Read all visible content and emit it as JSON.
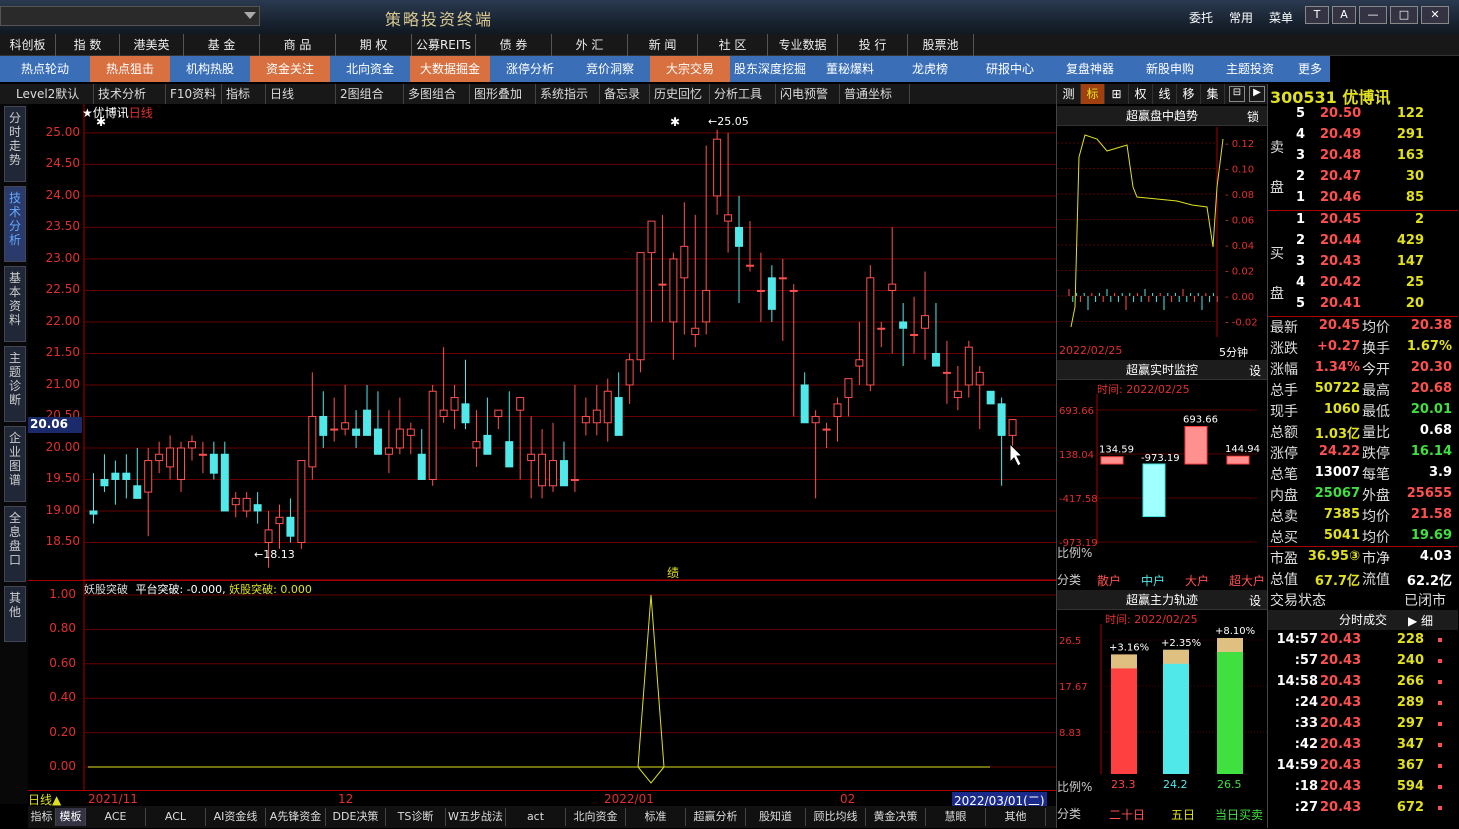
{
  "window": {
    "title": "策略投资终端",
    "menus": [
      "委托",
      "常用",
      "菜单"
    ]
  },
  "nav1": [
    "科创板",
    "指 数",
    "港美英",
    "基 金",
    "商 品",
    "期 权",
    "公募REITs",
    "债 券",
    "外 汇",
    "新 闻",
    "社 区",
    "专业数据",
    "投 行",
    "股票池"
  ],
  "nav2": [
    "热点轮动",
    "热点狙击",
    "机构热股",
    "资金关注",
    "北向资金",
    "大数据掘金",
    "涨停分析",
    "竞价洞察",
    "大宗交易",
    "股东深度挖掘",
    "董秘爆料",
    "龙虎榜",
    "研报中心",
    "复盘神器",
    "新股申购",
    "主题投资",
    "更多"
  ],
  "toolbar": [
    "Level2默认",
    "技术分析",
    "F10资料",
    "指标",
    "日线",
    "2图组合",
    "多图组合",
    "图形叠加",
    "系统指示",
    "备忘录",
    "历史回忆",
    "分析工具",
    "闪电预警",
    "普通坐标"
  ],
  "left_tabs": [
    "分时走势",
    "技术分析",
    "基本资料",
    "主题诊断",
    "企业图谱",
    "全息盘口",
    "其他"
  ],
  "main": {
    "name": "★优博讯",
    "period": "日线",
    "y_ticks": [
      "25.00",
      "24.50",
      "24.00",
      "23.50",
      "23.00",
      "22.50",
      "22.00",
      "21.50",
      "21.00",
      "20.50",
      "20.00",
      "19.50",
      "19.00",
      "18.50"
    ],
    "current_price": "20.06",
    "high_label": "25.05",
    "low_label": "18.13",
    "marker": "绩"
  },
  "sub": {
    "title": "妖股突破",
    "line2": "平台突破: -0.000,",
    "line3": "妖股突破: 0.000",
    "y_ticks": [
      "1.00",
      "0.80",
      "0.60",
      "0.40",
      "0.20",
      "0.00"
    ]
  },
  "timebar": {
    "period": "日线▲",
    "dates": [
      "2021/11",
      "12",
      "2022/01",
      "02",
      "2022/03/01(二)"
    ]
  },
  "bottom_tabs": [
    "指标",
    "模板",
    "ACE",
    "ACL",
    "AI资金线",
    "A先锋资金",
    "DDE决策",
    "TS诊断",
    "W五步战法",
    "act",
    "北向资金",
    "标准",
    "超赢分析",
    "股知道",
    "顾比均线",
    "黄金决策",
    "慧眼",
    "其他"
  ],
  "mid": {
    "tabs": [
      "测",
      "标",
      "⊞",
      "权",
      "线",
      "移",
      "集"
    ],
    "p1": {
      "title": "超赢盘中趋势",
      "lock": "锁",
      "date": "2022/02/25",
      "interval": "5分钟",
      "ticks": [
        "0.12",
        "0.10",
        "0.08",
        "0.06",
        "0.04",
        "0.02",
        "0.00",
        "-0.02"
      ]
    },
    "p2": {
      "title": "超赢实时监控",
      "setting": "设",
      "time_label": "时间: 2022/02/25",
      "ticks": [
        "693.66",
        "138.04",
        "-417.58",
        "-973.19"
      ],
      "values_label": [
        "134.59",
        "-973.19",
        "693.66",
        "144.94"
      ],
      "ratio": "比例%",
      "categories_label": "分类",
      "cats": [
        "散户",
        "中户",
        "大户",
        "超大户"
      ]
    },
    "p3": {
      "title": "超赢主力轨迹",
      "setting": "设",
      "time_label": "时间: 2022/02/25",
      "pcts": [
        "+3.16%",
        "+2.35%",
        "+8.10%"
      ],
      "ticks": [
        "26.5",
        "17.67",
        "8.83"
      ],
      "vals": [
        "23.3",
        "24.2",
        "26.5"
      ],
      "ratio": "比例%",
      "categories_label": "分类",
      "cats": [
        "二十日",
        "五日",
        "当日买卖"
      ]
    }
  },
  "quote": {
    "code": "300531",
    "name": "优博讯",
    "sell_label": "卖 盘",
    "buy_label": "买 盘",
    "sells": [
      [
        "5",
        "20.50",
        "122"
      ],
      [
        "4",
        "20.49",
        "291"
      ],
      [
        "3",
        "20.48",
        "163"
      ],
      [
        "2",
        "20.47",
        "30"
      ],
      [
        "1",
        "20.46",
        "85"
      ]
    ],
    "buys": [
      [
        "1",
        "20.45",
        "2"
      ],
      [
        "2",
        "20.44",
        "429"
      ],
      [
        "3",
        "20.43",
        "147"
      ],
      [
        "4",
        "20.42",
        "25"
      ],
      [
        "5",
        "20.41",
        "20"
      ]
    ],
    "stats": [
      [
        "最新",
        "20.45",
        "均价",
        "20.38"
      ],
      [
        "涨跌",
        "+0.27",
        "换手",
        "1.67%"
      ],
      [
        "涨幅",
        "1.34%",
        "今开",
        "20.30"
      ],
      [
        "总手",
        "50722",
        "最高",
        "20.68"
      ],
      [
        "现手",
        "1060",
        "最低",
        "20.01"
      ],
      [
        "总额",
        "1.03亿",
        "量比",
        "0.68"
      ],
      [
        "涨停",
        "24.22",
        "跌停",
        "16.14"
      ],
      [
        "总笔",
        "13007",
        "每笔",
        "3.9"
      ],
      [
        "内盘",
        "25067",
        "外盘",
        "25655"
      ],
      [
        "总卖",
        "7385",
        "均价",
        "21.58"
      ],
      [
        "总买",
        "5041",
        "均价",
        "19.69"
      ],
      [
        "市盈",
        "36.95③",
        "市净",
        "4.03"
      ],
      [
        "总值",
        "67.7亿",
        "流值",
        "62.2亿"
      ]
    ],
    "trade_state_label": "交易状态",
    "trade_state": "已闭市",
    "ticks_title": "分时成交",
    "ticks_btn": "细",
    "trades": [
      [
        "14:57",
        "20.43",
        "228"
      ],
      [
        ":57",
        "20.43",
        "240"
      ],
      [
        "14:58",
        "20.43",
        "266"
      ],
      [
        ":24",
        "20.43",
        "289"
      ],
      [
        ":33",
        "20.43",
        "297"
      ],
      [
        ":42",
        "20.43",
        "347"
      ],
      [
        "14:59",
        "20.43",
        "367"
      ],
      [
        ":18",
        "20.43",
        "594"
      ],
      [
        ":27",
        "20.43",
        "672"
      ]
    ]
  },
  "chart_data": {
    "type": "candlestick",
    "y_range": [
      18.0,
      25.3
    ],
    "candles": [
      [
        19.0,
        19.6,
        18.8,
        18.95
      ],
      [
        19.5,
        19.9,
        19.3,
        19.4
      ],
      [
        19.6,
        19.8,
        19.1,
        19.5
      ],
      [
        19.6,
        19.9,
        19.2,
        19.5
      ],
      [
        19.4,
        20.0,
        19.2,
        19.2
      ],
      [
        19.3,
        20.0,
        18.6,
        19.8
      ],
      [
        19.8,
        20.1,
        19.6,
        19.9
      ],
      [
        19.7,
        20.2,
        19.5,
        20.0
      ],
      [
        19.5,
        20.1,
        19.3,
        20.0
      ],
      [
        20.0,
        20.2,
        19.8,
        20.1
      ],
      [
        19.9,
        20.1,
        19.6,
        19.9
      ],
      [
        19.9,
        20.1,
        19.5,
        19.6
      ],
      [
        19.9,
        20.1,
        19.0,
        19.0
      ],
      [
        19.1,
        19.3,
        18.9,
        19.2
      ],
      [
        19.0,
        19.3,
        18.9,
        19.2
      ],
      [
        19.1,
        19.3,
        18.8,
        19.0
      ],
      [
        18.5,
        19.0,
        18.1,
        18.7
      ],
      [
        18.8,
        19.1,
        18.4,
        18.9
      ],
      [
        18.9,
        19.2,
        18.5,
        18.6
      ],
      [
        18.5,
        19.8,
        18.4,
        19.8
      ],
      [
        19.7,
        21.2,
        19.5,
        20.5
      ],
      [
        20.5,
        20.9,
        20.0,
        20.2
      ],
      [
        20.3,
        20.8,
        20.1,
        20.3
      ],
      [
        20.3,
        21.0,
        20.2,
        20.4
      ],
      [
        20.3,
        20.6,
        20.0,
        20.2
      ],
      [
        20.6,
        21.0,
        20.3,
        20.2
      ],
      [
        20.3,
        20.9,
        19.9,
        19.9
      ],
      [
        19.9,
        20.6,
        19.6,
        20.0
      ],
      [
        20.0,
        20.8,
        19.9,
        20.3
      ],
      [
        20.2,
        20.4,
        19.9,
        20.3
      ],
      [
        19.9,
        20.3,
        19.5,
        19.5
      ],
      [
        19.5,
        21.0,
        19.4,
        20.9
      ],
      [
        20.5,
        21.6,
        20.4,
        20.6
      ],
      [
        20.6,
        21.0,
        20.3,
        20.8
      ],
      [
        20.7,
        21.4,
        20.3,
        20.4
      ],
      [
        20.0,
        20.6,
        19.7,
        20.1
      ],
      [
        20.2,
        20.8,
        19.9,
        19.9
      ],
      [
        20.5,
        20.6,
        20.3,
        20.6
      ],
      [
        20.1,
        20.9,
        19.8,
        19.7
      ],
      [
        20.6,
        20.8,
        19.5,
        20.8
      ],
      [
        19.8,
        20.5,
        19.2,
        19.9
      ],
      [
        19.4,
        20.3,
        19.2,
        19.9
      ],
      [
        19.4,
        20.4,
        19.3,
        19.8
      ],
      [
        19.8,
        20.1,
        19.5,
        19.4
      ],
      [
        19.5,
        21.0,
        19.3,
        19.5
      ],
      [
        20.4,
        20.8,
        20.2,
        20.5
      ],
      [
        20.4,
        21.0,
        20.2,
        20.6
      ],
      [
        20.4,
        21.1,
        20.1,
        20.9
      ],
      [
        20.8,
        21.2,
        20.4,
        20.2
      ],
      [
        21.0,
        21.5,
        20.7,
        21.4
      ],
      [
        21.4,
        23.0,
        21.2,
        23.1
      ],
      [
        23.1,
        23.6,
        22.0,
        23.6
      ],
      [
        22.6,
        23.7,
        22.0,
        22.6
      ],
      [
        22.0,
        23.1,
        21.4,
        23.0
      ],
      [
        22.7,
        23.9,
        21.8,
        23.2
      ],
      [
        21.8,
        23.7,
        21.6,
        21.9
      ],
      [
        22.0,
        24.8,
        21.8,
        22.5
      ],
      [
        24.0,
        25.05,
        23.7,
        24.9
      ],
      [
        23.6,
        25.0,
        23.1,
        23.7
      ],
      [
        23.5,
        24.0,
        22.3,
        23.2
      ],
      [
        22.9,
        23.6,
        22.8,
        22.9
      ],
      [
        22.5,
        23.1,
        22.0,
        22.5
      ],
      [
        22.7,
        22.9,
        22.0,
        22.2
      ],
      [
        22.7,
        23.0,
        21.7,
        22.7
      ],
      [
        22.5,
        22.6,
        20.5,
        22.5
      ],
      [
        21.0,
        21.2,
        20.4,
        20.4
      ],
      [
        20.4,
        20.6,
        19.2,
        20.5
      ],
      [
        20.3,
        20.4,
        20.0,
        20.3
      ],
      [
        20.5,
        20.8,
        20.1,
        20.7
      ],
      [
        20.8,
        21.0,
        20.5,
        21.1
      ],
      [
        21.3,
        22.0,
        21.0,
        21.4
      ],
      [
        21.0,
        22.9,
        20.9,
        22.7
      ],
      [
        21.9,
        22.0,
        21.6,
        21.9
      ],
      [
        22.5,
        23.5,
        21.5,
        22.6
      ],
      [
        22.0,
        22.3,
        21.3,
        21.9
      ],
      [
        21.8,
        22.4,
        21.5,
        21.8
      ],
      [
        21.9,
        22.8,
        21.4,
        22.1
      ],
      [
        21.5,
        22.3,
        21.3,
        21.3
      ],
      [
        21.2,
        21.7,
        20.7,
        21.2
      ],
      [
        20.8,
        21.3,
        20.6,
        20.9
      ],
      [
        21.0,
        21.7,
        20.8,
        21.6
      ],
      [
        21.0,
        21.3,
        20.3,
        21.2
      ],
      [
        20.9,
        20.9,
        20.7,
        20.7
      ],
      [
        20.7,
        20.8,
        19.4,
        20.2
      ],
      [
        20.2,
        20.4,
        19.8,
        20.45
      ]
    ]
  }
}
